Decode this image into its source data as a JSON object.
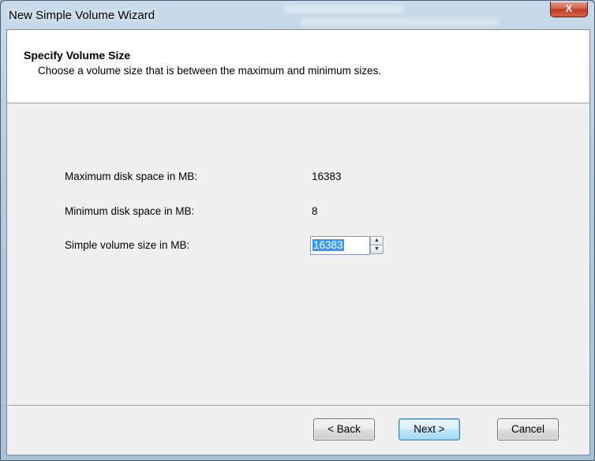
{
  "window": {
    "title": "New Simple Volume Wizard",
    "close_glyph": "X"
  },
  "header": {
    "title": "Specify Volume Size",
    "subtitle": "Choose a volume size that is between the maximum and minimum sizes."
  },
  "form": {
    "max_label": "Maximum disk space in MB:",
    "max_value": "16383",
    "min_label": "Minimum disk space in MB:",
    "min_value": "8",
    "size_label": "Simple volume size in MB:",
    "size_value": "16383"
  },
  "buttons": {
    "back": "< Back",
    "next": "Next >",
    "cancel": "Cancel"
  },
  "icons": {
    "close": "close-icon",
    "spin_up": "chevron-up-icon",
    "spin_down": "chevron-down-icon"
  },
  "colors": {
    "selection": "#3399ff",
    "close_button": "#c03c24",
    "default_button": "#bee6fd"
  }
}
